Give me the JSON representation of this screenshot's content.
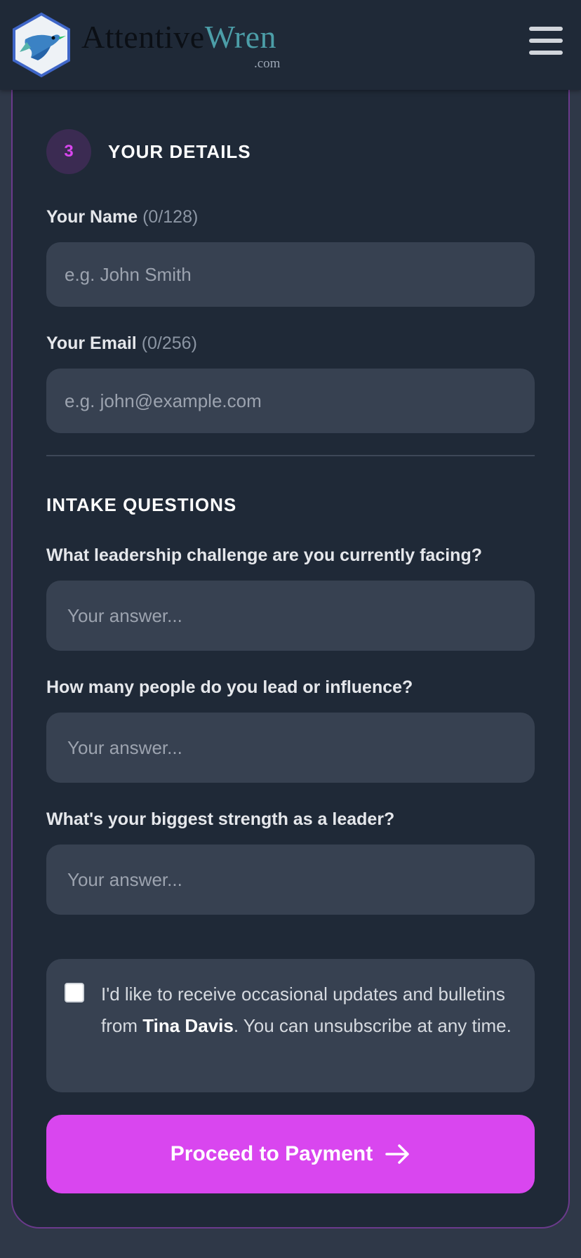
{
  "header": {
    "brand_part1": "Attentive",
    "brand_part2": "Wren",
    "brand_suffix": ".com",
    "menu_icon": "hamburger-menu-icon",
    "logo_icon": "wren-bird-logo"
  },
  "details": {
    "step_number": "3",
    "title": "YOUR DETAILS",
    "name": {
      "label": "Your Name",
      "count": "(0/128)",
      "placeholder": "e.g. John Smith",
      "value": ""
    },
    "email": {
      "label": "Your Email",
      "count": "(0/256)",
      "placeholder": "e.g. john@example.com",
      "value": ""
    }
  },
  "intake": {
    "title": "INTAKE QUESTIONS",
    "questions": [
      {
        "label": "What leadership challenge are you currently facing?",
        "placeholder": "Your answer...",
        "value": ""
      },
      {
        "label": "How many people do you lead or influence?",
        "placeholder": "Your answer...",
        "value": ""
      },
      {
        "label": "What's your biggest strength as a leader?",
        "placeholder": "Your answer...",
        "value": ""
      }
    ]
  },
  "consent": {
    "checked": false,
    "text_before": "I'd like to receive occasional updates and bulletins from ",
    "name": "Tina Davis",
    "text_after": ". You can unsubscribe at any time."
  },
  "submit": {
    "label": "Proceed to Payment",
    "icon": "arrow-right-icon"
  },
  "colors": {
    "accent": "#d946ef",
    "background": "#1f2937",
    "input_bg": "#374151",
    "card_border": "#6b3a8c"
  }
}
